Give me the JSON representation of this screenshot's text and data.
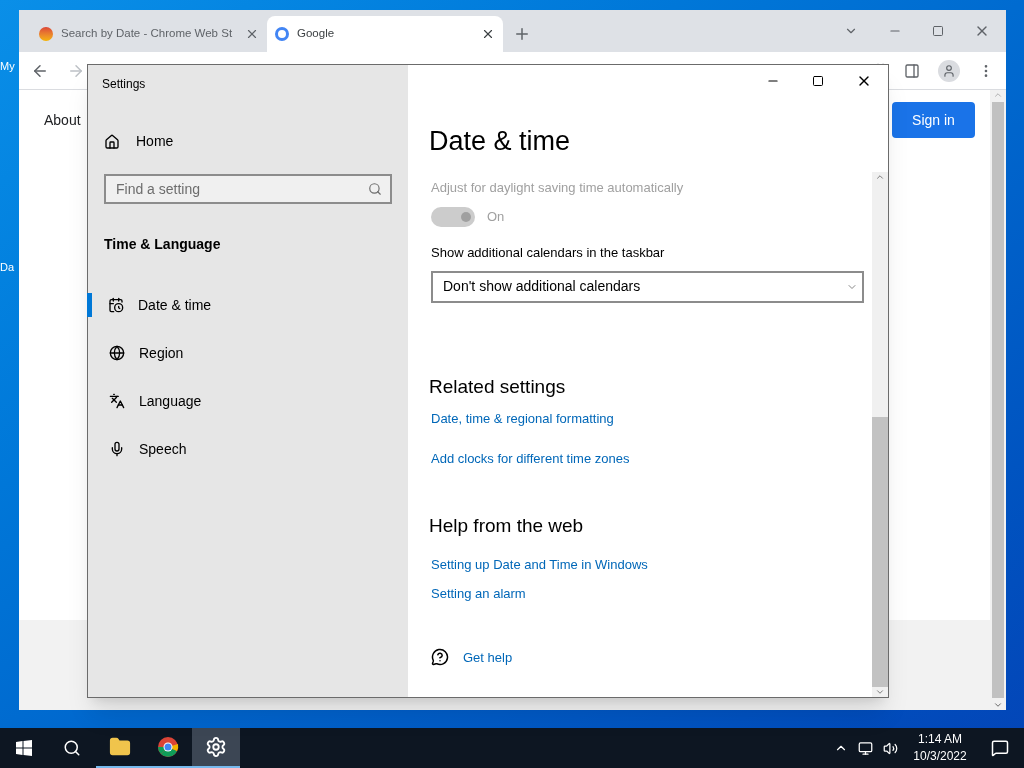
{
  "desktop": {
    "icons": [
      {
        "label": "My"
      },
      {
        "label": "Da"
      }
    ]
  },
  "browser": {
    "tabs": [
      {
        "title": "Search by Date - Chrome Web St",
        "selected": false
      },
      {
        "title": "Google",
        "selected": true
      }
    ],
    "page": {
      "link": "About",
      "button": "Sign in"
    }
  },
  "settings": {
    "title": "Settings",
    "home": "Home",
    "search": {
      "placeholder": "Find a setting"
    },
    "section": "Time & Language",
    "nav": [
      {
        "label": "Date & time",
        "selected": true
      },
      {
        "label": "Region",
        "selected": false
      },
      {
        "label": "Language",
        "selected": false
      },
      {
        "label": "Speech",
        "selected": false
      }
    ],
    "heading": "Date & time",
    "dst": {
      "label": "Adjust for daylight saving time automatically",
      "on": true,
      "disabled": true,
      "state_text": "On"
    },
    "calendars": {
      "label": "Show additional calendars in the taskbar",
      "value": "Don't show additional calendars"
    },
    "related": {
      "heading": "Related settings",
      "links": [
        "Date, time & regional formatting",
        "Add clocks for different time zones"
      ]
    },
    "help": {
      "heading": "Help from the web",
      "links": [
        "Setting up Date and Time in Windows",
        "Setting an alarm"
      ]
    },
    "get_help": "Get help"
  },
  "taskbar": {
    "apps": [
      {
        "selected": false
      },
      {
        "selected": false
      },
      {
        "selected": true
      }
    ],
    "time": "1:14 AM",
    "date": "10/3/2022"
  }
}
